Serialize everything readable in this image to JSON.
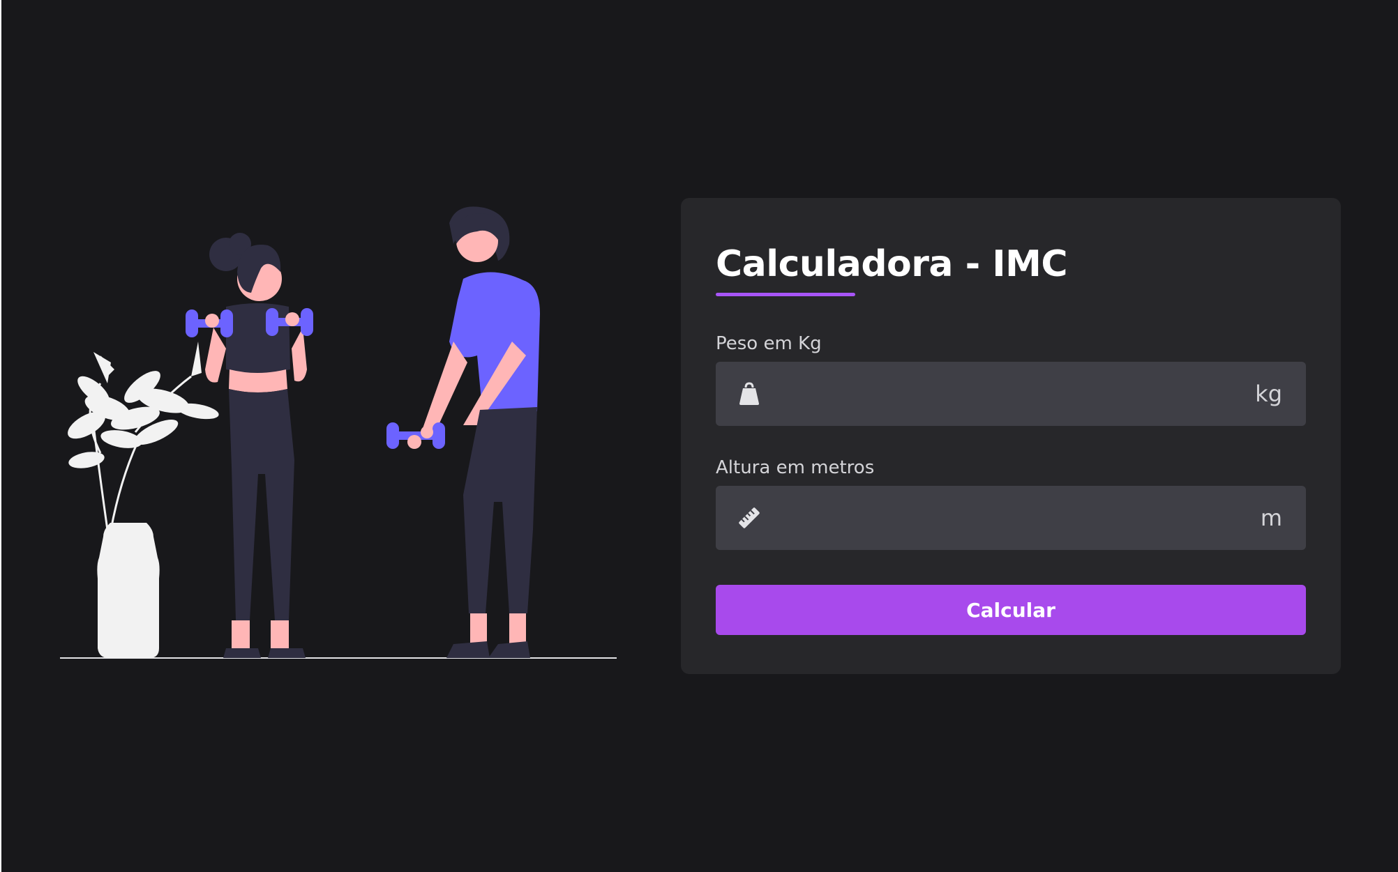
{
  "card": {
    "title": "Calculadora - IMC",
    "weight": {
      "label": "Peso em Kg",
      "value": "",
      "placeholder": "",
      "unit": "kg",
      "icon": "weight-icon"
    },
    "height": {
      "label": "Altura em metros",
      "value": "",
      "placeholder": "",
      "unit": "m",
      "icon": "ruler-icon"
    },
    "button_label": "Calcular"
  },
  "colors": {
    "background": "#18181b",
    "card": "#27272a",
    "input": "#3f3f46",
    "accent": "#a855f7",
    "illustration_accent": "#6c63ff",
    "skin": "#ffb6b6",
    "clothing_dark": "#2f2e41"
  }
}
